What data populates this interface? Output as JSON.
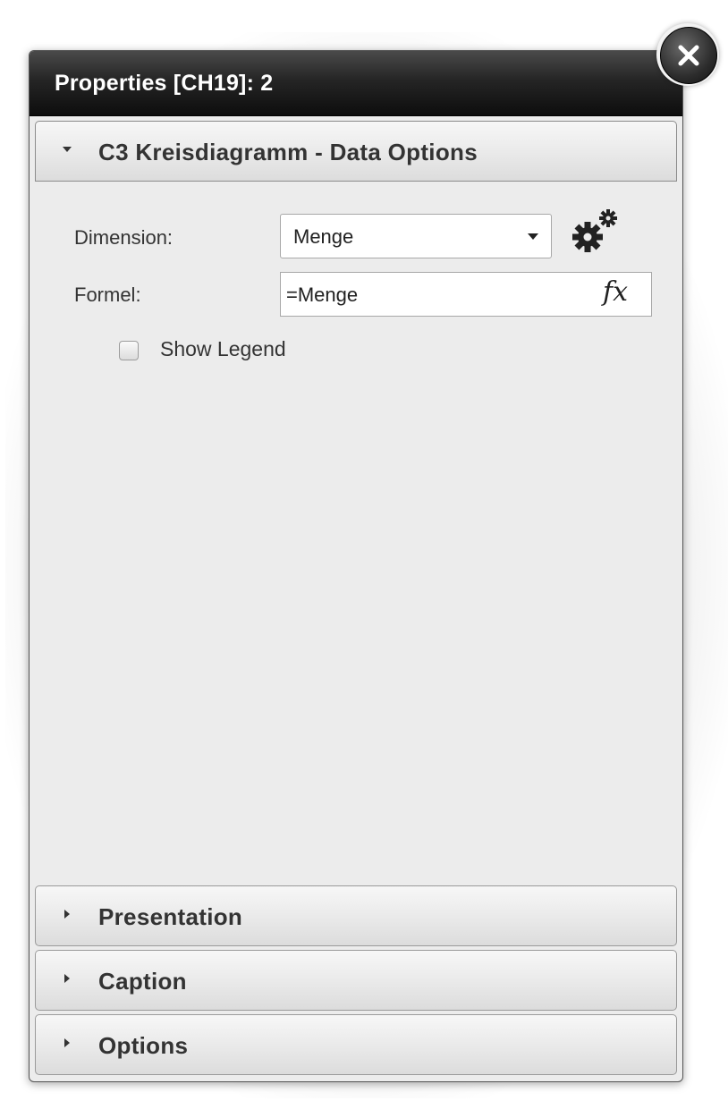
{
  "dialog": {
    "title": "Properties [CH19]: 2",
    "close_icon": "close-icon"
  },
  "sections": [
    {
      "label": "C3 Kreisdiagramm - Data Options",
      "expanded": true
    },
    {
      "label": "Presentation",
      "expanded": false
    },
    {
      "label": "Caption",
      "expanded": false
    },
    {
      "label": "Options",
      "expanded": false
    }
  ],
  "data_options": {
    "dimension_label": "Dimension:",
    "dimension_value": "Menge",
    "settings_icon": "gears-icon",
    "formula_label": "Formel:",
    "formula_value": "=Menge",
    "formula_button": "fx",
    "show_legend_label": "Show Legend",
    "show_legend_checked": false
  },
  "colors": {
    "titlebar": "#1a1a1a",
    "panel_bg": "#ececec",
    "header_text": "#333333"
  }
}
